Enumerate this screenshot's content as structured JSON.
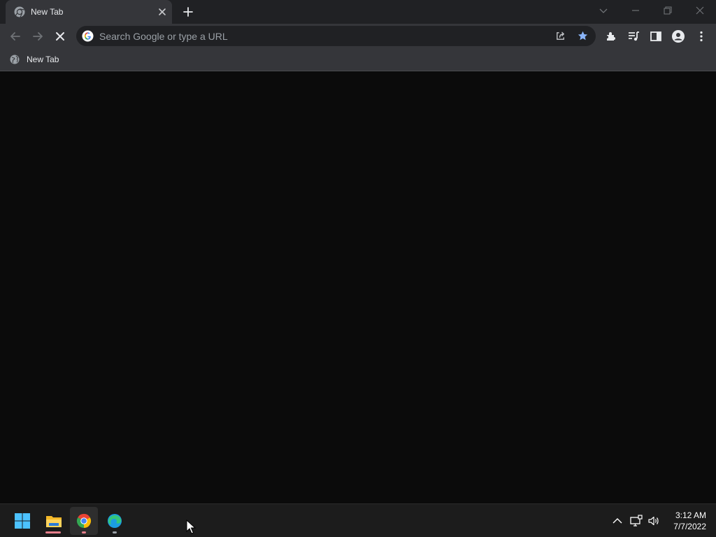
{
  "window": {
    "tabs": [
      {
        "title": "New Tab",
        "favicon": "chrome-icon",
        "active": true
      }
    ],
    "new_tab_icon": "plus-icon",
    "controls": [
      "tab-search-icon",
      "minimize-icon",
      "restore-icon",
      "close-icon"
    ]
  },
  "toolbar": {
    "back_icon": "arrow-left-icon",
    "forward_icon": "arrow-right-icon",
    "stop_icon": "close-icon",
    "omnibox": {
      "value": "",
      "placeholder": "Search Google or type a URL",
      "leading_icon": "google-g-icon",
      "trailing_icons": [
        "share-icon",
        "star-icon"
      ]
    },
    "right_icons": [
      "extensions-icon",
      "media-queue-icon",
      "side-panel-icon",
      "profile-icon",
      "more-vert-icon"
    ]
  },
  "bookmarks": {
    "items": [
      {
        "label": "New Tab",
        "icon": "globe-icon"
      }
    ]
  },
  "taskbar": {
    "apps": [
      {
        "name": "start",
        "icon": "windows-icon"
      },
      {
        "name": "file-explorer",
        "icon": "folder-icon"
      },
      {
        "name": "chrome",
        "icon": "chrome-icon",
        "active": true
      },
      {
        "name": "edge",
        "icon": "edge-icon"
      }
    ],
    "tray_icons": [
      "chevron-up-icon",
      "network-icon",
      "volume-icon"
    ],
    "clock": {
      "time": "3:12 AM",
      "date": "7/7/2022"
    }
  },
  "colors": {
    "titlebar_bg": "#202124",
    "toolbar_bg": "#35363a",
    "omnibox_bg": "#202124",
    "content_bg": "#0b0b0b",
    "taskbar_bg": "#1c1c1c",
    "star_accent": "#8ab4f8"
  }
}
